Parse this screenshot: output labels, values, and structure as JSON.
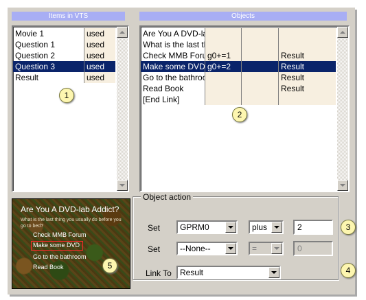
{
  "headers": {
    "items_in_vts": "Items in VTS",
    "objects": "Objects"
  },
  "vts_items": [
    {
      "name": "Movie 1",
      "status": "used",
      "selected": false
    },
    {
      "name": "Question 1",
      "status": "used",
      "selected": false
    },
    {
      "name": "Question 2",
      "status": "used",
      "selected": false
    },
    {
      "name": "Question 3",
      "status": "used",
      "selected": true
    },
    {
      "name": "Result",
      "status": "used",
      "selected": false
    }
  ],
  "objects": [
    {
      "name": "Are You A DVD-lab",
      "action": "",
      "extra": "",
      "link": "",
      "selected": false
    },
    {
      "name": "What is the last thin",
      "action": "",
      "extra": "",
      "link": "",
      "selected": false
    },
    {
      "name": "Check MMB Forum",
      "action": "g0+=1",
      "extra": "",
      "link": "Result",
      "selected": false
    },
    {
      "name": "Make some DVD",
      "action": "g0+=2",
      "extra": "",
      "link": "Result",
      "selected": true
    },
    {
      "name": "Go to the bathroom",
      "action": "",
      "extra": "",
      "link": "Result",
      "selected": false
    },
    {
      "name": "Read Book",
      "action": "",
      "extra": "",
      "link": "Result",
      "selected": false
    },
    {
      "name": "[End Link]",
      "action": "",
      "extra": "",
      "link": "",
      "selected": false
    }
  ],
  "object_action": {
    "group_label": "Object action",
    "set1_label": "Set",
    "set1_register": "GPRM0",
    "set1_operator": "plus",
    "set1_value": "2",
    "set2_label": "Set",
    "set2_register": "--None--",
    "set2_operator": "=",
    "set2_value": "0",
    "link_to_label": "Link To",
    "link_to_value": "Result"
  },
  "preview": {
    "title": "Are You A DVD-lab Addict?",
    "subtitle": "What is the last thing you usually do before you go to bed?",
    "items": [
      "Check MMB Forum",
      "Make some DVD",
      "Go to the bathroom",
      "Read Book"
    ]
  },
  "callouts": [
    "1",
    "2",
    "3",
    "4",
    "5"
  ],
  "colors": {
    "header_bg": "#a8aef4",
    "selection_bg": "#0a246a",
    "cell_tan": "#f7efe0",
    "panel_bg": "#d4d0c8"
  }
}
